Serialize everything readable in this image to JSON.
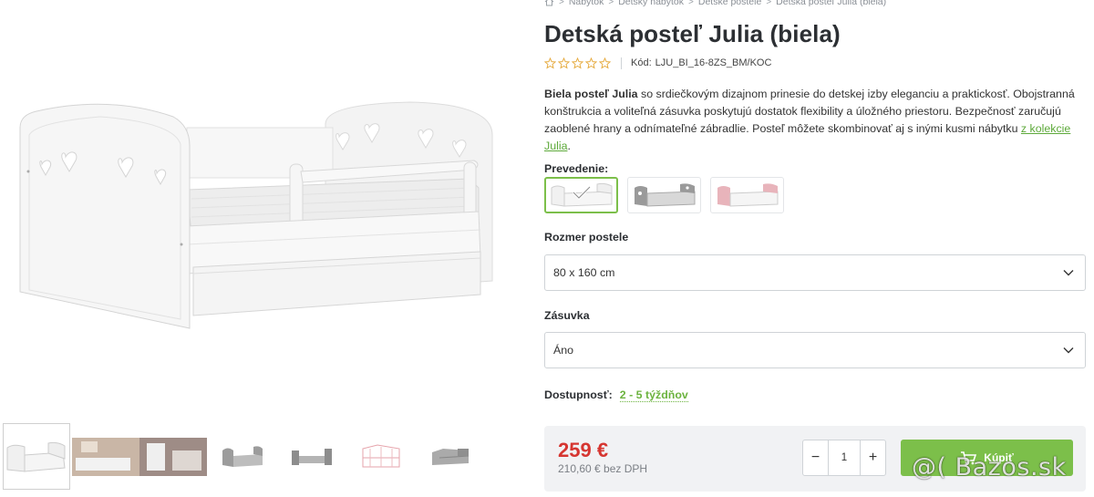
{
  "breadcrumb": {
    "home_icon": "home-icon",
    "items": [
      "Nábytok",
      "Detský nábytok",
      "Detské postele",
      "Detská posteľ Julia (biela)"
    ]
  },
  "product": {
    "title": "Detská posteľ Julia (biela)",
    "rating_stars": 5,
    "rating_value": 0,
    "code_label": "Kód:",
    "code_value": "LJU_BI_16-8ZS_BM/KOC",
    "description_bold": "Biela posteľ Julia",
    "description_text": " so srdiečkovým dizajnom prinesie do detskej izby eleganciu a praktickosť. Obojstranná konštrukcia a voliteľná zásuvka poskytujú dostatok flexibility a úložného priestoru. Bezpečnosť zaručujú zaoblené hrany a odnímateľné zábradlie. Posteľ môžete skombinovať aj s inými kusmi nábytku ",
    "description_link": "z kolekcie Julia",
    "description_end": "."
  },
  "options": {
    "variant_label": "Prevedenie:",
    "variants": [
      {
        "name": "biela",
        "color": "#ffffff",
        "selected": true
      },
      {
        "name": "sivá",
        "color": "#9a9a9a",
        "selected": false
      },
      {
        "name": "ružová",
        "color": "#e8b4bb",
        "selected": false
      }
    ],
    "size_label": "Rozmer postele",
    "size_value": "80 x 160 cm",
    "drawer_label": "Zásuvka",
    "drawer_value": "Áno"
  },
  "availability": {
    "label": "Dostupnosť:",
    "value": "2 - 5 týždňov"
  },
  "buy": {
    "price": "259 €",
    "price_net": "210,60 € bez DPH",
    "quantity": "1",
    "minus": "−",
    "plus": "+",
    "button_label": "Kúpiť"
  },
  "gallery": {
    "thumbnails": 7,
    "active_index": 0
  },
  "watermark": "@( Bazos.sk",
  "colors": {
    "accent": "#7cbf4a",
    "price": "#d63631",
    "availability": "#6cb33f",
    "star": "#e5a93b"
  }
}
